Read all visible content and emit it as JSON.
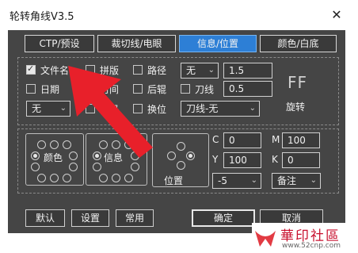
{
  "window": {
    "title": "轮转角线V3.5",
    "close_glyph": "✕"
  },
  "tabs": [
    {
      "label": "CTP/预设",
      "active": false
    },
    {
      "label": "裁切线/电眼",
      "active": false
    },
    {
      "label": "信息/位置",
      "active": true
    },
    {
      "label": "颜色/白底",
      "active": false
    }
  ],
  "options": {
    "filename": {
      "label": "文件名",
      "checked": true
    },
    "stitch": {
      "label": "拼版",
      "checked": false
    },
    "path": {
      "label": "路径",
      "checked": false
    },
    "date": {
      "label": "日期",
      "checked": false
    },
    "time": {
      "label": "时间",
      "checked": false
    },
    "rear_roller": {
      "label": "后辊",
      "checked": false
    },
    "knife_line": {
      "label": "刀线",
      "checked": false
    },
    "page": {
      "label": "页码",
      "checked": false
    },
    "swap_position": {
      "label": "换位",
      "checked": false
    }
  },
  "fields": {
    "mode_select": "无",
    "size_value": "1.5",
    "knife_value": "0.5",
    "left_select": "无",
    "knife_select": "刀线-无",
    "c_label": "C",
    "c_value": "0",
    "m_label": "M",
    "m_value": "100",
    "y_label": "Y",
    "y_value": "100",
    "k_label": "K",
    "k_value": "0",
    "offset_select": "-5",
    "note_select": "备注"
  },
  "rotate": {
    "glyph": "FF",
    "label": "旋转"
  },
  "position_groups": [
    {
      "label": "颜色"
    },
    {
      "label": "信息"
    },
    {
      "label": "位置"
    }
  ],
  "buttons": {
    "default": "默认",
    "settings": "设置",
    "common": "常用",
    "ok": "确定",
    "cancel": "取消"
  },
  "watermark": {
    "text": "華印社區",
    "url": "www.52cnp.com"
  },
  "colors": {
    "dialog_bg": "#454545",
    "active_tab": "#2d7fd6",
    "arrow": "#e8202a"
  },
  "icons": {
    "close": "close-icon",
    "chevron": "chevron-down-icon",
    "rotate": "rotate-ff-icon"
  }
}
